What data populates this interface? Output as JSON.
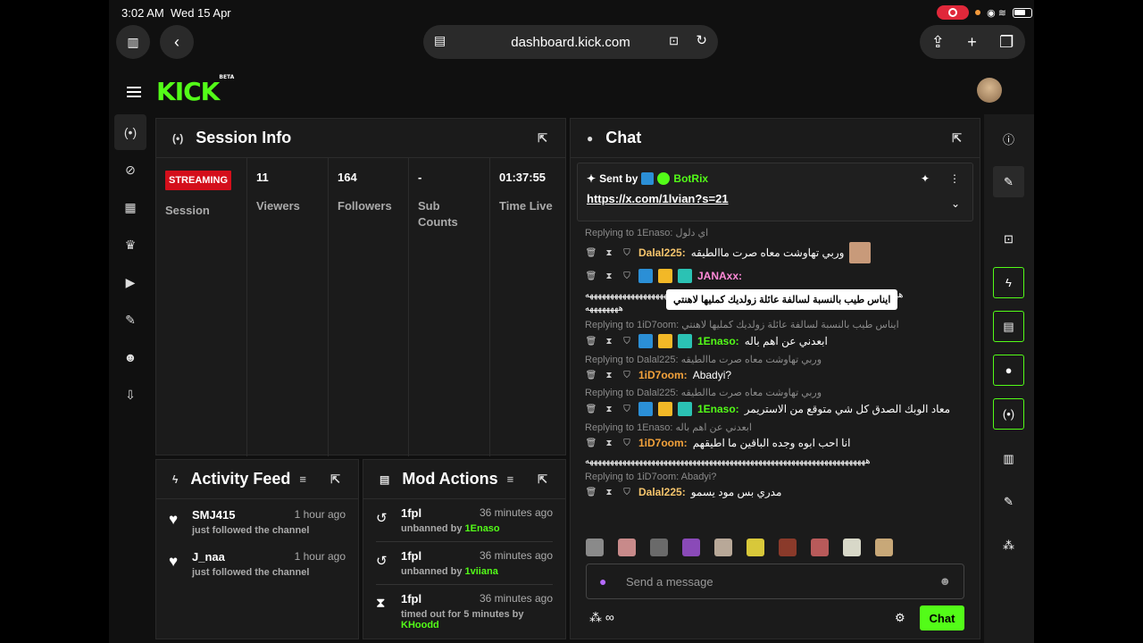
{
  "status": {
    "time": "3:02 AM",
    "date": "Wed 15 Apr"
  },
  "browser": {
    "url": "dashboard.kick.com"
  },
  "brand": {
    "logo": "KICK",
    "beta": "BETA",
    "accent": "#53fc18"
  },
  "session": {
    "title": "Session Info",
    "streaming": "STREAMING",
    "session_label": "Session",
    "stats": [
      {
        "value": "11",
        "label": "Viewers"
      },
      {
        "value": "164",
        "label": "Followers"
      },
      {
        "value": "-",
        "label": "Sub Counts"
      },
      {
        "value": "01:37:55",
        "label": "Time Live"
      }
    ]
  },
  "activity": {
    "title": "Activity Feed",
    "items": [
      {
        "user": "SMJ415",
        "time": "1 hour ago",
        "text": "just followed the channel"
      },
      {
        "user": "J_naa",
        "time": "1 hour ago",
        "text": "just followed the channel"
      }
    ]
  },
  "mod": {
    "title": "Mod Actions",
    "items": [
      {
        "user": "1fpl",
        "time": "36 minutes ago",
        "action": "unbanned by",
        "by": "1Enaso"
      },
      {
        "user": "1fpl",
        "time": "36 minutes ago",
        "action": "unbanned by",
        "by": "1viiana"
      },
      {
        "user": "1fpl",
        "time": "36 minutes ago",
        "action": "timed out for 5 minutes by",
        "by": "KHoodd"
      }
    ]
  },
  "chat": {
    "title": "Chat",
    "pinned": {
      "sent_by": "Sent by",
      "bot": "BotRix",
      "link": "https://x.com/1lvian?s=21"
    },
    "messages": [
      {
        "reply": "Replying to 1Enaso: اي دلول",
        "user": "Dalal225:",
        "color": "#f5c46c",
        "text": "وربي تهاوشت معاه صرت ماالطيقه"
      },
      {
        "reply": "",
        "user": "JANAxx:",
        "color": "#ff8ad8",
        "text": ""
      },
      {
        "reply": "Replying to 1iD7oom: ايناس طيب بالنسبة لسالفة عائلة زولديك كمليها لاهنتي",
        "user": "1Enaso:",
        "color": "#53fc18",
        "text": "ابعدني عن اهم باله"
      },
      {
        "reply": "Replying to Dalal225: وربي تهاوشت معاه صرت ماالطيقه",
        "user": "1iD7oom:",
        "color": "#f3a23b",
        "text": "Abadyi?"
      },
      {
        "reply": "Replying to Dalal225: وربي تهاوشت معاه صرت ماالطيقه",
        "user": "1Enaso:",
        "color": "#53fc18",
        "text": "معاد الوبك الصدق كل شي متوقع من الاستريمر"
      },
      {
        "reply": "Replying to 1Enaso: ابعدني عن اهم باله",
        "user": "1iD7oom:",
        "color": "#f3a23b",
        "text": "انا احب ابوه وجده الباقين ما اطيقهم"
      },
      {
        "reply": "Replying to 1iD7oom: Abadyi?",
        "user": "Dalal225:",
        "color": "#f5c46c",
        "text": "مدري بس مود يسمو"
      }
    ],
    "spam1": "ههههههههههههههههههههههههههههههههههههههههههههههههههههههههههههههههههههههههههههه",
    "spam1b": "ههههههههه",
    "spam2": "ههههههههههههههههههههههههههههههههههههههههههههههههههههههههههههههههههههه",
    "tooltip": "ايناس طيب بالنسبة لسالفة عائلة زولديك كمليها لاهنتي",
    "input_placeholder": "Send a message",
    "send_label": "Chat"
  }
}
